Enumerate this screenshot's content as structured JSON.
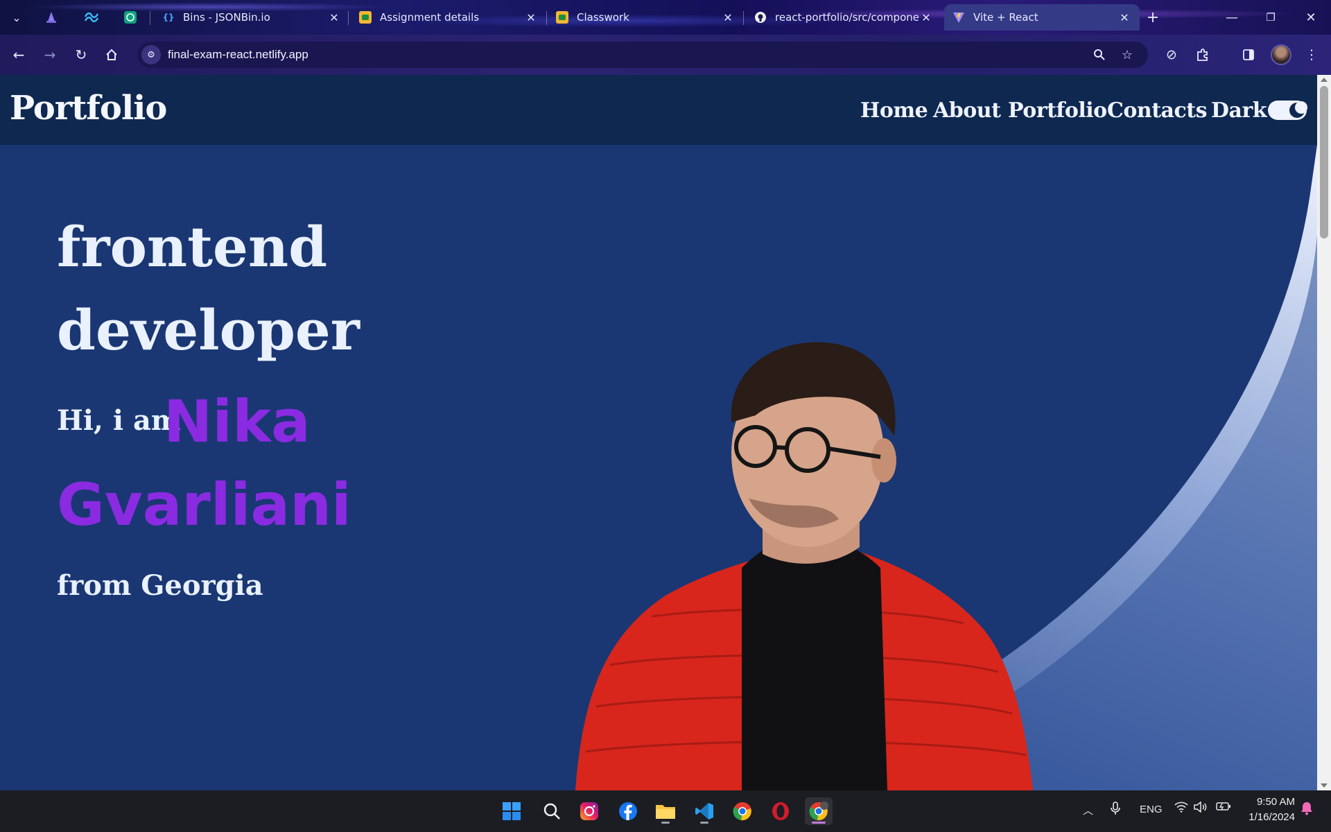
{
  "browser": {
    "tabs": [
      {
        "title": "Bins - JSONBin.io",
        "favicon": "jsonbin-braces-icon",
        "active": false
      },
      {
        "title": "Assignment details",
        "favicon": "google-classroom-icon",
        "active": false
      },
      {
        "title": "Classwork",
        "favicon": "google-classroom-icon",
        "active": false
      },
      {
        "title": "react-portfolio/src/componen",
        "favicon": "github-icon",
        "active": false
      },
      {
        "title": "Vite + React",
        "favicon": "vite-icon",
        "active": true
      }
    ],
    "pinned": [
      "wizard-hat-icon",
      "tailwind-icon",
      "chatgpt-icon"
    ],
    "new_tab_label": "+",
    "url": "final-exam-react.netlify.app"
  },
  "site": {
    "logo": "Portfolio",
    "nav": {
      "home": "Home",
      "about": "About",
      "portfolio": "Portfolio",
      "contacts": "Contacts",
      "theme_label": "Dark"
    },
    "hero": {
      "role_line1": "frontend",
      "role_line2": "developer",
      "greeting": "Hi, i am",
      "first_name": "Nika",
      "last_name": "Gvarliani",
      "origin": "from Georgia"
    }
  },
  "taskbar": {
    "apps": [
      "windows-start-icon",
      "search-icon",
      "instagram-icon",
      "facebook-icon",
      "file-explorer-icon",
      "vscode-icon",
      "chrome-icon",
      "opera-icon",
      "chrome-profile-icon"
    ],
    "language": "ENG",
    "time": "9:50 AM",
    "date": "1/16/2024"
  },
  "colors": {
    "page_bg": "#1a3773",
    "header_bg": "#0f2850",
    "accent_name": "#8a2be2",
    "text": "#e9f1ff"
  }
}
